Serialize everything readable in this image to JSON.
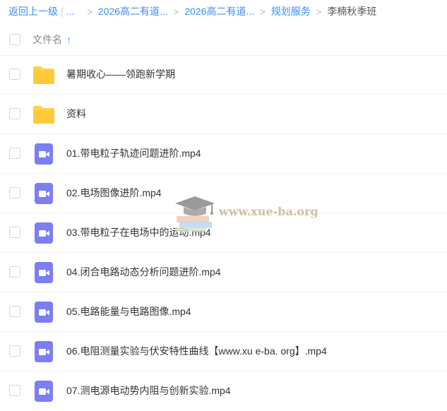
{
  "breadcrumb": {
    "back": "返回上一级",
    "separator_bar": "|",
    "ellipsis": "...",
    "separator": ">",
    "items": [
      {
        "label": "2026高二有道..."
      },
      {
        "label": "2026高二有道..."
      },
      {
        "label": "规划服务"
      }
    ],
    "current": "李楠秋季班"
  },
  "header": {
    "column_label": "文件名",
    "sort_arrow": "↑"
  },
  "files": [
    {
      "name": "暑期收心——领跑新学期",
      "type": "folder",
      "icon": "folder-icon"
    },
    {
      "name": "资料",
      "type": "folder",
      "icon": "folder-icon"
    },
    {
      "name": "01.带电粒子轨迹问题进阶.mp4",
      "type": "video",
      "icon": "video-file-icon"
    },
    {
      "name": "02.电场图像进阶.mp4",
      "type": "video",
      "icon": "video-file-icon"
    },
    {
      "name": "03.带电粒子在电场中的运动.mp4",
      "type": "video",
      "icon": "video-file-icon"
    },
    {
      "name": "04.闭合电路动态分析问题进阶.mp4",
      "type": "video",
      "icon": "video-file-icon"
    },
    {
      "name": "05.电路能量与电路图像.mp4",
      "type": "video",
      "icon": "video-file-icon"
    },
    {
      "name": "06.电阻测量实验与伏安特性曲线【www.xu e-ba. org】.mp4",
      "type": "video",
      "icon": "video-file-icon"
    },
    {
      "name": "07.测电源电动势内阻与创新实验.mp4",
      "type": "video",
      "icon": "video-file-icon"
    }
  ],
  "watermark": {
    "text": "www.xue-ba.org",
    "icon": "graduation-cap-icon"
  },
  "colors": {
    "link": "#3b8cff",
    "folder": "#ffd04b",
    "video": "#7b7ff2"
  }
}
